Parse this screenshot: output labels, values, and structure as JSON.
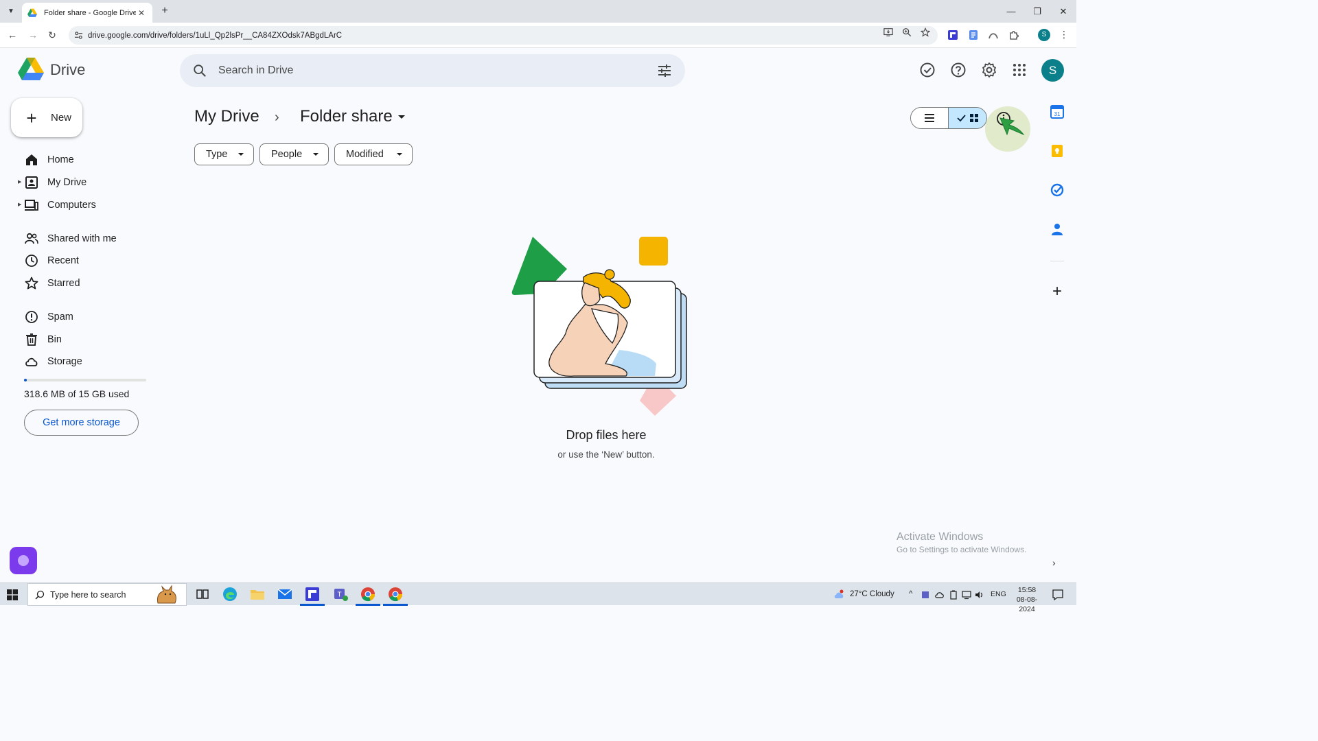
{
  "browser": {
    "tab_title": "Folder share - Google Drive",
    "url": "drive.google.com/drive/folders/1uLl_Qp2lsPr__CA84ZXOdsk7ABgdLArC",
    "profile_initial": "S"
  },
  "header": {
    "app_name": "Drive",
    "search_placeholder": "Search in Drive",
    "account_initial": "S"
  },
  "sidebar": {
    "new_label": "New",
    "items": [
      {
        "label": "Home",
        "icon": "home-icon"
      },
      {
        "label": "My Drive",
        "icon": "my-drive-icon"
      },
      {
        "label": "Computers",
        "icon": "computers-icon"
      },
      {
        "label": "Shared with me",
        "icon": "shared-icon"
      },
      {
        "label": "Recent",
        "icon": "clock-icon"
      },
      {
        "label": "Starred",
        "icon": "star-icon"
      },
      {
        "label": "Spam",
        "icon": "spam-icon"
      },
      {
        "label": "Bin",
        "icon": "bin-icon"
      },
      {
        "label": "Storage",
        "icon": "cloud-icon"
      }
    ],
    "storage_text": "318.6 MB of 15 GB used",
    "storage_fraction": 0.02,
    "get_storage_label": "Get more storage"
  },
  "main": {
    "breadcrumb_root": "My Drive",
    "breadcrumb_sep": "›",
    "breadcrumb_current": "Folder share",
    "filters": [
      "Type",
      "People",
      "Modified"
    ],
    "empty_title": "Drop files here",
    "empty_subtitle": "or use the ‘New’ button."
  },
  "watermark": {
    "line1": "Activate Windows",
    "line2": "Go to Settings to activate Windows."
  },
  "taskbar": {
    "search_text": "Type here to search",
    "weather": "27°C  Cloudy",
    "lang": "ENG",
    "time": "15:58",
    "date": "08-08-2024"
  },
  "colors": {
    "accent": "#0b57d0",
    "selected_toggle": "#c2e7ff",
    "avatar": "#0b7f8a"
  }
}
